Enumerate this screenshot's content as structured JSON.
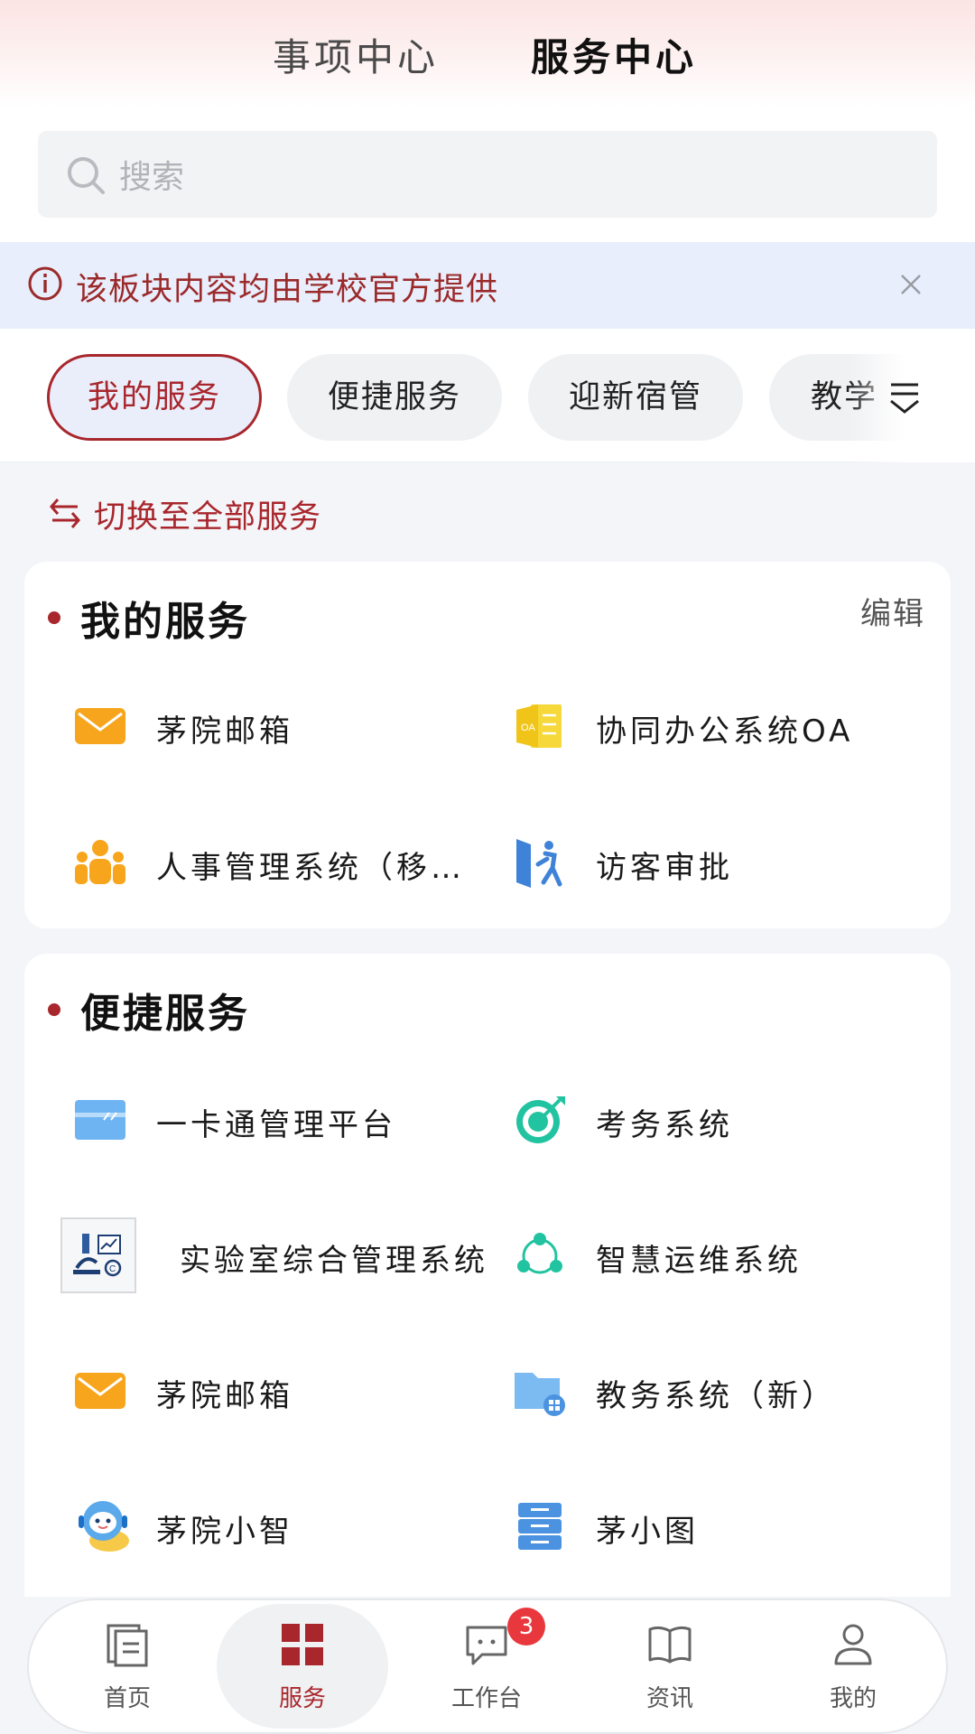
{
  "header": {
    "tab_inactive": "事项中心",
    "tab_active": "服务中心"
  },
  "search": {
    "placeholder": "搜索"
  },
  "notice": {
    "text": "该板块内容均由学校官方提供"
  },
  "categories": [
    "我的服务",
    "便捷服务",
    "迎新宿管",
    "教学"
  ],
  "switch_label": "切换至全部服务",
  "my_services": {
    "title": "我的服务",
    "edit_label": "编辑",
    "items": [
      {
        "label": "茅院邮箱",
        "icon": "mail-icon"
      },
      {
        "label": "协同办公系统OA",
        "icon": "oa-document-icon"
      },
      {
        "label": "人事管理系统（移…",
        "icon": "people-icon"
      },
      {
        "label": "访客审批",
        "icon": "visitor-door-icon"
      }
    ]
  },
  "quick_services": {
    "title": "便捷服务",
    "items": [
      {
        "label": "一卡通管理平台",
        "icon": "card-icon"
      },
      {
        "label": "考务系统",
        "icon": "target-icon"
      },
      {
        "label": "实验室综合管理系统",
        "icon": "lab-icon"
      },
      {
        "label": "智慧运维系统",
        "icon": "network-icon"
      },
      {
        "label": "茅院邮箱",
        "icon": "mail-icon"
      },
      {
        "label": "教务系统（新）",
        "icon": "folder-icon"
      },
      {
        "label": "茅院小智",
        "icon": "robot-icon"
      },
      {
        "label": "茅小图",
        "icon": "server-icon"
      }
    ]
  },
  "bottom_nav": {
    "items": [
      {
        "label": "首页",
        "icon": "home-icon"
      },
      {
        "label": "服务",
        "icon": "grid-icon"
      },
      {
        "label": "工作台",
        "icon": "chat-icon",
        "badge": "3"
      },
      {
        "label": "资讯",
        "icon": "book-icon"
      },
      {
        "label": "我的",
        "icon": "person-icon"
      }
    ]
  },
  "colors": {
    "accent": "#a8272d",
    "badge": "#e8383d",
    "notice_bg": "#e8eefc"
  }
}
